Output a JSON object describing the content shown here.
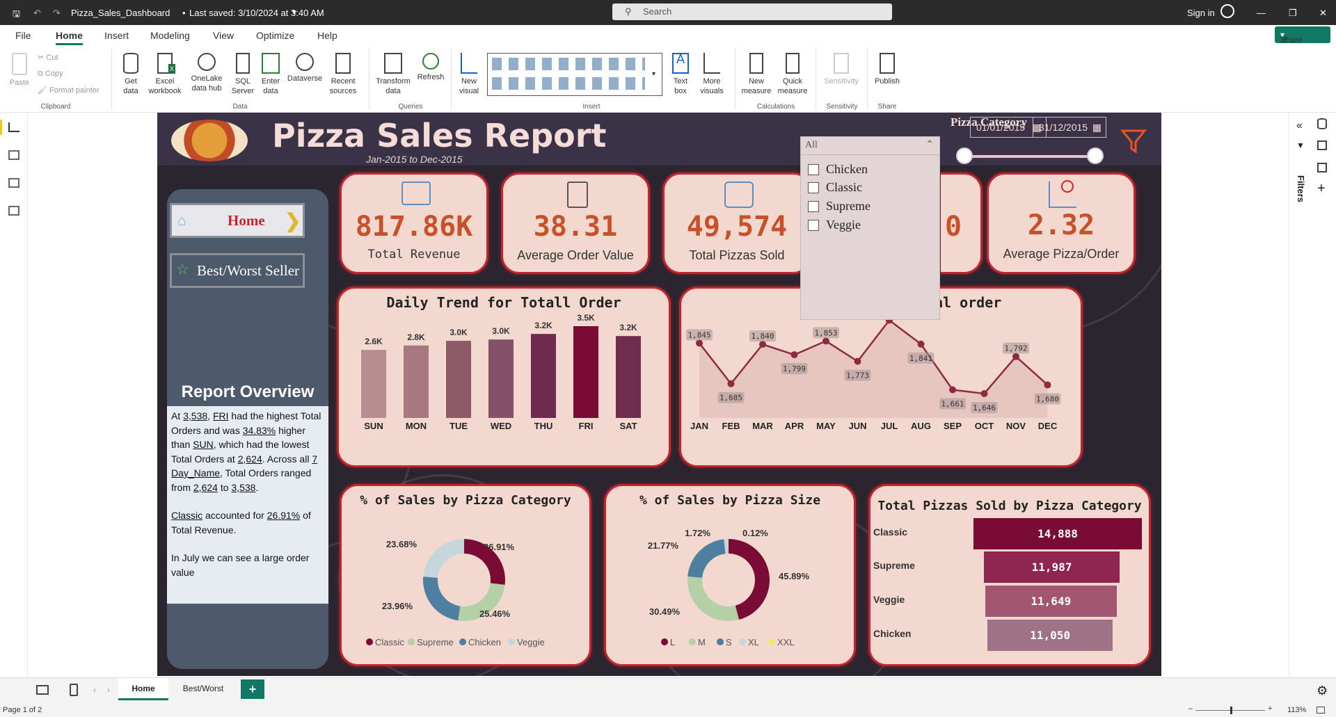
{
  "titlebar": {
    "filename": "Pizza_Sales_Dashboard",
    "saved": "Last saved: 3/10/2024 at 3:40 AM",
    "search_placeholder": "Search",
    "signin": "Sign in"
  },
  "menu": [
    "File",
    "Home",
    "Insert",
    "Modeling",
    "View",
    "Optimize",
    "Help"
  ],
  "share_label": "Share",
  "ribbon": {
    "clipboard": {
      "paste": "Paste",
      "cut": "Cut",
      "copy": "Copy",
      "format_painter": "Format painter",
      "group": "Clipboard"
    },
    "data": {
      "get_data": [
        "Get",
        "data"
      ],
      "excel": [
        "Excel",
        "workbook"
      ],
      "onelake": [
        "OneLake",
        "data hub"
      ],
      "sql": [
        "SQL",
        "Server"
      ],
      "enter": [
        "Enter",
        "data"
      ],
      "dataverse": "Dataverse",
      "recent": [
        "Recent",
        "sources"
      ],
      "group": "Data"
    },
    "queries": {
      "transform": [
        "Transform",
        "data"
      ],
      "refresh": "Refresh",
      "group": "Queries"
    },
    "insert": {
      "new_visual": [
        "New",
        "visual"
      ],
      "text_box": [
        "Text",
        "box"
      ],
      "more_visuals": [
        "More",
        "visuals"
      ],
      "group": "Insert"
    },
    "calculations": {
      "new_measure": [
        "New",
        "measure"
      ],
      "quick_measure": [
        "Quick",
        "measure"
      ],
      "group": "Calculations"
    },
    "sensitivity": {
      "label": "Sensitivity",
      "group": "Sensitivity"
    },
    "share": {
      "publish": "Publish",
      "group": "Share"
    }
  },
  "report": {
    "title": "Pizza Sales Report",
    "subtitle": "Jan-2015 to Dec-2015",
    "date_from": "01/01/2015",
    "date_to": "31/12/2015",
    "nav": {
      "home": "Home",
      "best_worst": "Best/Worst Seller"
    },
    "slicer": {
      "title": "Pizza Category",
      "selected": "All",
      "options": [
        "Chicken",
        "Classic",
        "Supreme",
        "Veggie"
      ]
    },
    "kpis": [
      {
        "value": "817.86K",
        "label": "Total Revenue"
      },
      {
        "value": "38.31",
        "label": "Average Order Value"
      },
      {
        "value": "49,574",
        "label": "Total Pizzas Sold"
      },
      {
        "value": "0",
        "label": ""
      },
      {
        "value": "2.32",
        "label": "Average Pizza/Order"
      }
    ],
    "overview": {
      "title": "Report Overview",
      "p1_a": "At ",
      "p1_v1": "3,538",
      "p1_b": ", ",
      "p1_v2": "FRI",
      "p1_c": " had the highest Total Orders and was ",
      "p1_v3": "34.83%",
      "p1_d": " higher than ",
      "p1_v4": "SUN",
      "p1_e": ", which had the lowest Total Orders at ",
      "p1_v5": "2,624",
      "p1_f": ". Across all ",
      "p1_v6": "7",
      "p1_g": " ",
      "p1_v7": "Day_Name",
      "p1_h": ", Total Orders ranged from ",
      "p1_v8": "2,624",
      "p1_i": " to ",
      "p1_v9": "3,538",
      "p1_j": ".",
      "p2_v1": "Classic",
      "p2_a": " accounted for ",
      "p2_v2": "26.91%",
      "p2_b": " of Total Revenue.",
      "p3": "In July we can see a large order value"
    }
  },
  "chart_data": [
    {
      "type": "bar",
      "title": "Daily Trend for Totall Order",
      "categories": [
        "SUN",
        "MON",
        "TUE",
        "WED",
        "THU",
        "FRI",
        "SAT"
      ],
      "values": [
        2624,
        2794,
        2973,
        3024,
        3239,
        3538,
        3158
      ],
      "labels": [
        "2.6K",
        "2.8K",
        "3.0K",
        "3.0K",
        "3.2K",
        "3.5K",
        "3.2K"
      ],
      "colors": [
        "#b68d90",
        "#a7787f",
        "#8e5a68",
        "#84506a",
        "#6e2b4d",
        "#7a0b34",
        "#6f2e4e"
      ]
    },
    {
      "type": "line",
      "title": "for Total order",
      "categories": [
        "JAN",
        "FEB",
        "MAR",
        "APR",
        "MAY",
        "JUN",
        "JUL",
        "AUG",
        "SEP",
        "OCT",
        "NOV",
        "DEC"
      ],
      "values": [
        1845,
        1685,
        1840,
        1799,
        1853,
        1773,
        1935,
        1841,
        1661,
        1646,
        1792,
        1680
      ],
      "labels": [
        "1,845",
        "1,685",
        "1,840",
        "1,799",
        "1,853",
        "1,773",
        "1,935",
        "1,841",
        "1,661",
        "1,646",
        "1,792",
        "1,680"
      ]
    },
    {
      "type": "pie",
      "title": "% of Sales by Pizza Category",
      "categories": [
        "Classic",
        "Supreme",
        "Chicken",
        "Veggie"
      ],
      "values": [
        26.91,
        25.46,
        23.96,
        23.68
      ],
      "labels": [
        "26.91%",
        "25.46%",
        "23.96%",
        "23.68%"
      ],
      "colors": [
        "#7a0b34",
        "#b5cfa7",
        "#4d7fa0",
        "#c5d7dc"
      ]
    },
    {
      "type": "pie",
      "title": "% of Sales by Pizza Size",
      "categories": [
        "L",
        "M",
        "S",
        "XL",
        "XXL"
      ],
      "values": [
        45.89,
        30.49,
        21.77,
        1.72,
        0.12
      ],
      "labels": [
        "45.89%",
        "30.49%",
        "21.77%",
        "1.72%",
        "0.12%"
      ],
      "colors": [
        "#7a0b34",
        "#b5cfa7",
        "#4d7fa0",
        "#c5d7dc",
        "#f3e56b"
      ]
    },
    {
      "type": "bar",
      "title": "Total Pizzas Sold by Pizza Category",
      "categories": [
        "Classic",
        "Supreme",
        "Veggie",
        "Chicken"
      ],
      "values": [
        14888,
        11987,
        11649,
        11050
      ],
      "labels": [
        "14,888",
        "11,987",
        "11,649",
        "11,050"
      ],
      "colors": [
        "#7a0b34",
        "#8e2650",
        "#a35670",
        "#a07286"
      ]
    }
  ],
  "pages": {
    "home": "Home",
    "best_worst": "Best/Worst",
    "status": "Page 1 of 2",
    "zoom": "113%"
  },
  "filters_label": "Filters"
}
